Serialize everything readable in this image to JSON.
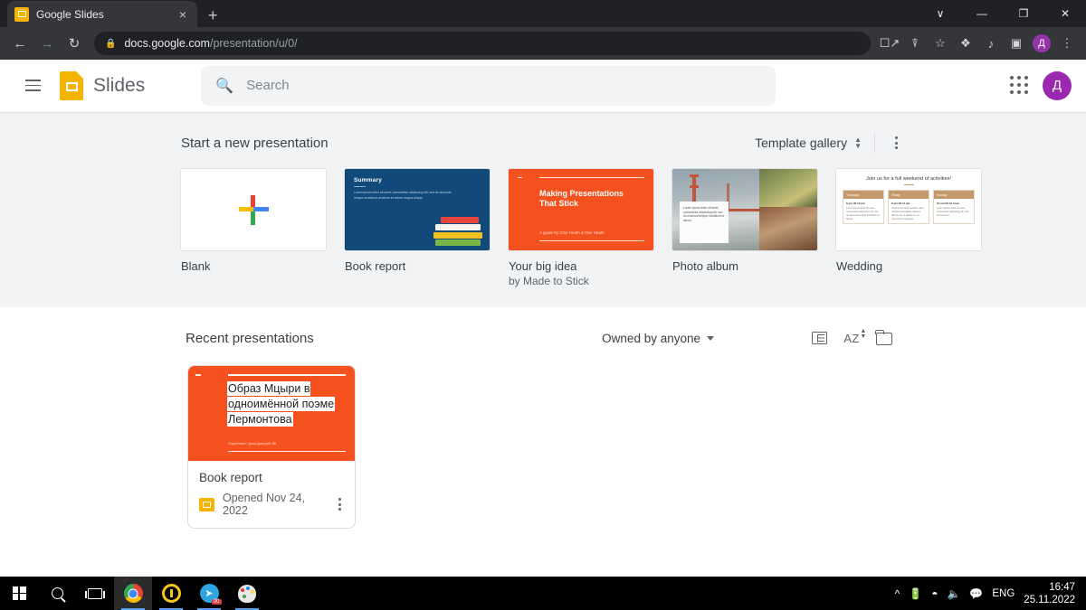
{
  "browser": {
    "tab": {
      "title": "Google Slides",
      "favicon": "slides-favicon",
      "close": "×"
    },
    "new_tab": "+",
    "window_controls": {
      "minimize_chrome": "∨",
      "minimize": "—",
      "maximize": "❐",
      "close": "✕"
    },
    "nav": {
      "back": "←",
      "forward": "→",
      "reload": "↻"
    },
    "omnibox": {
      "lock": "🔒",
      "domain": "docs.google.com",
      "path": "/presentation/u/0/"
    },
    "toolbar_icons": [
      "share-box-icon",
      "bookmark-share-icon",
      "star-icon",
      "extensions-icon",
      "media-list-icon",
      "sidepanel-icon"
    ],
    "profile_initial": "Д",
    "menu": "⋮"
  },
  "slides_header": {
    "menu_label": "Main menu",
    "app_name": "Slides",
    "search": {
      "placeholder": "Search",
      "value": ""
    },
    "apps_label": "Google apps",
    "avatar_initial": "Д"
  },
  "templates": {
    "section_title": "Start a new presentation",
    "gallery_label": "Template gallery",
    "items": [
      {
        "label": "Blank",
        "sub": "",
        "kind": "blank"
      },
      {
        "label": "Book report",
        "sub": "",
        "kind": "book",
        "thumb": {
          "heading": "Summary",
          "body": "Lorem ipsum dolor sit amet, consectetur adipiscing elit, sed do eiusmod tempor incididunt ut labore et dolore magna aliqua."
        }
      },
      {
        "label": "Your big idea",
        "sub": "by Made to Stick",
        "kind": "idea",
        "thumb": {
          "title": "Making Presentations That Stick",
          "byline": "A guide by Chip Heath & Dan Heath"
        }
      },
      {
        "label": "Photo album",
        "sub": "",
        "kind": "photo",
        "thumb": {
          "caption": "Lorem ipsum dolor sit amet, consectetur adipiscing elit, sed do eiusmod tempor incididunt ut labore."
        }
      },
      {
        "label": "Wedding",
        "sub": "",
        "kind": "wedding",
        "thumb": {
          "title": "Join us for a full weekend of activities!",
          "columns": [
            {
              "day": "Thursday",
              "head": "6 pm till 10 pm",
              "text": "Lorem ipsum dolor sit amet, consectetur adipiscing elit, sed do eiusmod tempor incididunt ut labore."
            },
            {
              "day": "Friday",
              "head": "9 am till 11 am",
              "text": "Ut enim ad minim veniam, quis nostrud exercitation ullamco laboris nisi ut aliquip ex ea commodo consequat."
            },
            {
              "day": "Sunday",
              "head": "10 am till 12 noon",
              "text": "Lorem ipsum dolor sit amet, consectetur adipiscing elit, sed do eiusmod."
            }
          ]
        }
      }
    ]
  },
  "recent": {
    "section_title": "Recent presentations",
    "owner_filter": "Owned by anyone",
    "view_icons": [
      "list-view-icon",
      "sort-az-icon",
      "folder-picker-icon"
    ],
    "documents": [
      {
        "name": "Book report",
        "opened": "Opened Nov 24, 2022",
        "thumb": {
          "title_lines": [
            "Образ Мцыри в",
            "одноимённой поэме",
            "Лермонтова"
          ],
          "author": "Подготовил: Чучки Дмитрий, 8В",
          "bg_color": "#f4511e"
        }
      }
    ]
  },
  "taskbar": {
    "apps": [
      "start-button",
      "search-button",
      "task-view-button",
      "chrome-app",
      "yandex-music-app",
      "telegram-app",
      "paint-app"
    ],
    "telegram_badge": "00",
    "tray": [
      "chevron-up-icon",
      "battery-icon",
      "wifi-icon",
      "volume-icon",
      "notifications-icon"
    ],
    "language": "ENG",
    "time": "16:47",
    "date": "25.11.2022"
  },
  "colors": {
    "slides_yellow": "#f5b400",
    "accent_orange": "#f4511e",
    "browser_dark": "#202124",
    "strip_bg": "#f1f3f4"
  }
}
